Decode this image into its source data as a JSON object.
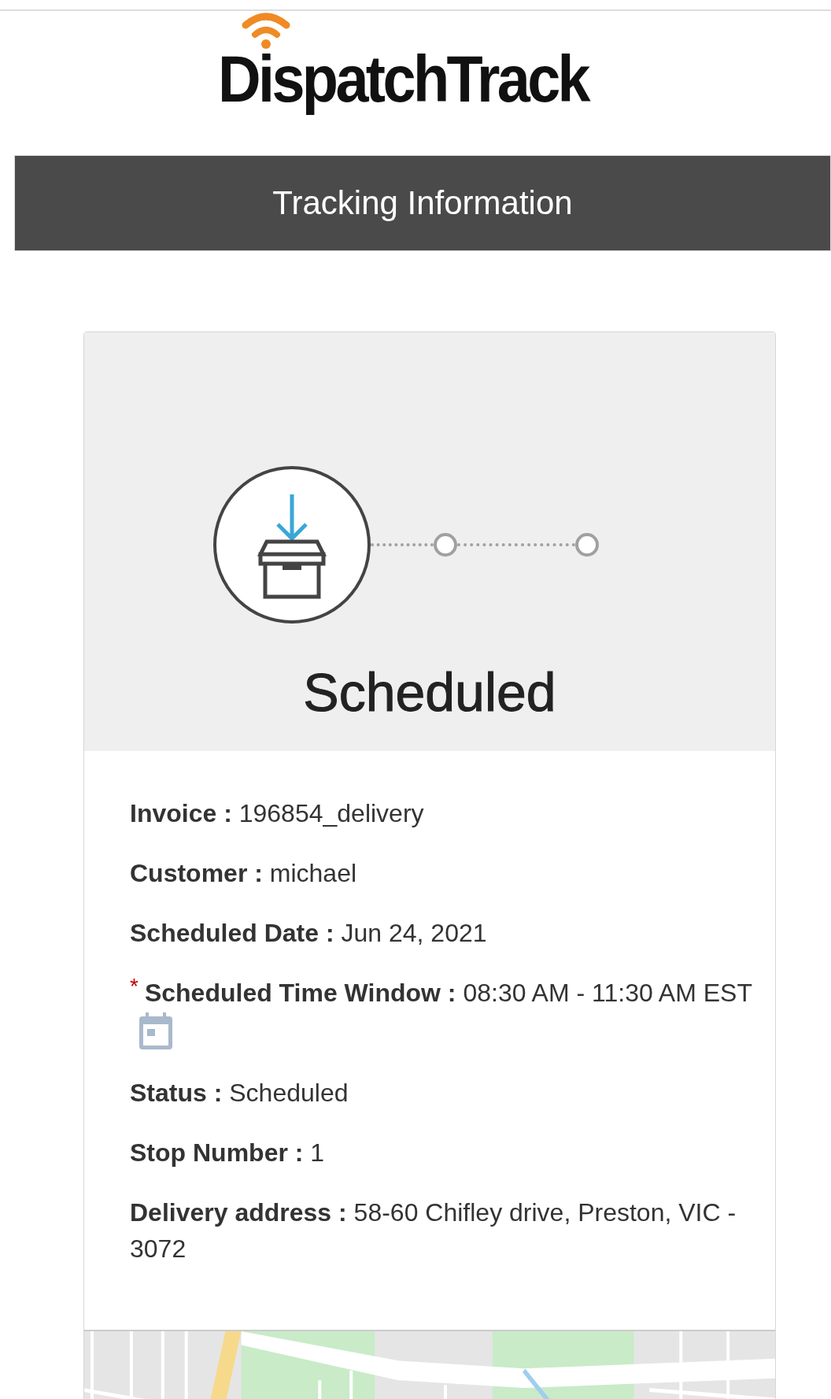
{
  "logo": {
    "text": "DispatchTrack"
  },
  "header": {
    "title": "Tracking Information"
  },
  "progress": {
    "steps": [
      {
        "selected": true
      },
      {
        "selected": false
      },
      {
        "selected": false
      }
    ],
    "status_title": "Scheduled"
  },
  "fields": [
    {
      "kind": "text",
      "required": false,
      "label": "Invoice :",
      "value": "196854_delivery"
    },
    {
      "kind": "text",
      "required": false,
      "label": "Customer :",
      "value": "michael"
    },
    {
      "kind": "text",
      "required": false,
      "label": "Scheduled Date :",
      "value": "Jun 24, 2021"
    },
    {
      "kind": "time_window",
      "required": true,
      "required_mark": "*",
      "label": "Scheduled Time Window :",
      "value": "08:30 AM - 11:30 AM EST"
    },
    {
      "kind": "text",
      "required": false,
      "label": "Status :",
      "value": "Scheduled"
    },
    {
      "kind": "text",
      "required": false,
      "label": "Stop Number :",
      "value": "1"
    },
    {
      "kind": "text",
      "required": false,
      "label": "Delivery address :",
      "value": "58-60 Chifley drive, Preston, VIC - 3072"
    }
  ]
}
